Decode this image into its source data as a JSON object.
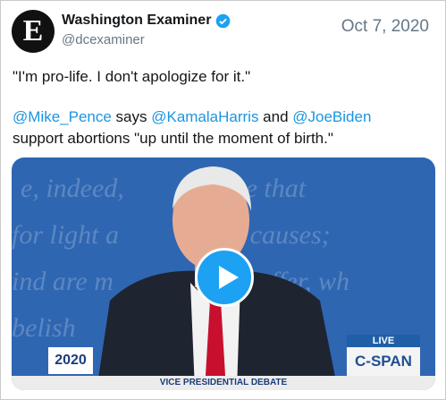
{
  "account": {
    "avatar_letter": "E",
    "name": "Washington Examiner",
    "handle": "@dcexaminer",
    "date": "Oct 7, 2020"
  },
  "tweet": {
    "line1": "\"I'm pro-life. I don't apologize for it.\"",
    "mention1": "@Mike_Pence",
    "says": " says ",
    "mention2": "@KamalaHarris",
    "and": " and ",
    "mention3": "@JoeBiden",
    "line_end": "support abortions \"up until the moment of birth.\""
  },
  "video": {
    "overlay": {
      "live": "LIVE",
      "brand": "C-SPAN",
      "logo": "2020",
      "banner": "VICE PRESIDENTIAL DEBATE"
    }
  },
  "colors": {
    "accent": "#1da1f2",
    "mention": "#1b95e0"
  }
}
